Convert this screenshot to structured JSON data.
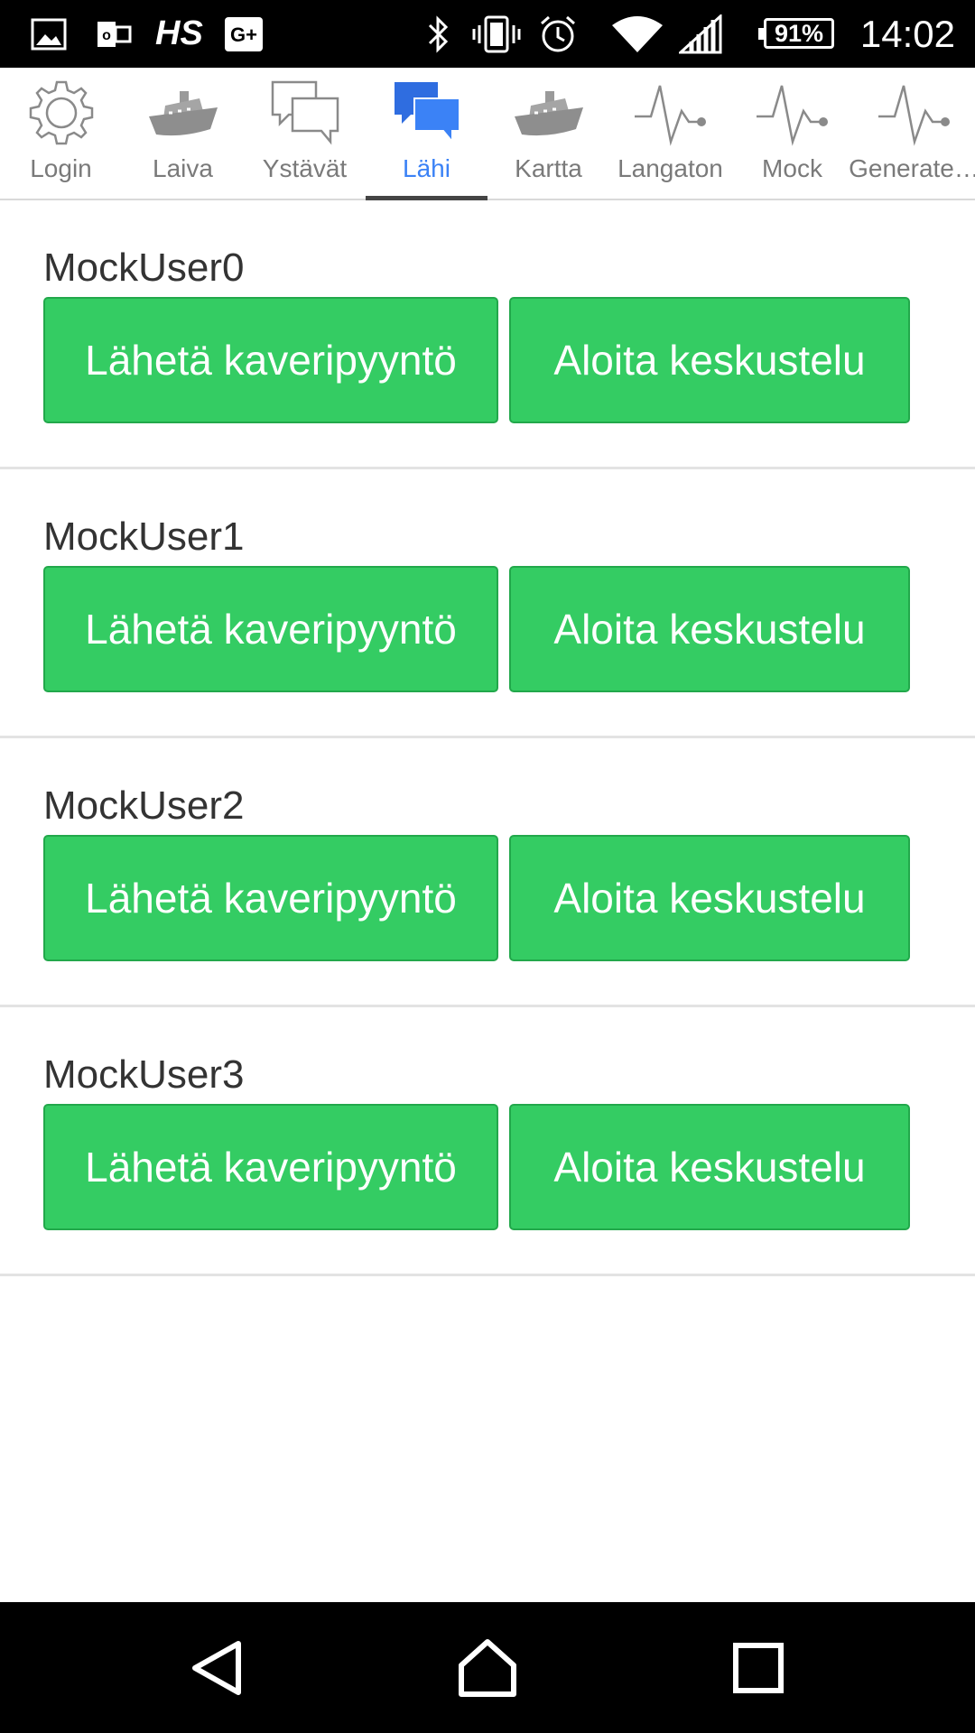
{
  "status_bar": {
    "time": "14:02",
    "battery": "91%",
    "left_text": "HS",
    "icons": [
      "image-icon",
      "outlook-icon",
      "hs-icon",
      "google-plus-icon",
      "bluetooth-icon",
      "vibrate-icon",
      "alarm-icon",
      "wifi-icon",
      "signal-icon",
      "battery-icon"
    ]
  },
  "tabs": [
    {
      "label": "Login",
      "icon": "gear-icon",
      "active": false
    },
    {
      "label": "Laiva",
      "icon": "ship-icon",
      "active": false
    },
    {
      "label": "Ystävät",
      "icon": "chat-bubbles-icon",
      "active": false
    },
    {
      "label": "Lähi",
      "icon": "chat-bubbles-icon",
      "active": true
    },
    {
      "label": "Kartta",
      "icon": "ship-icon",
      "active": false
    },
    {
      "label": "Langaton",
      "icon": "pulse-icon",
      "active": false
    },
    {
      "label": "Mock",
      "icon": "pulse-icon",
      "active": false
    },
    {
      "label": "Generate…",
      "icon": "pulse-icon",
      "active": false
    }
  ],
  "users": [
    {
      "name": "MockUser0",
      "friend_button": "Lähetä kaveripyyntö",
      "chat_button": "Aloita keskustelu"
    },
    {
      "name": "MockUser1",
      "friend_button": "Lähetä kaveripyyntö",
      "chat_button": "Aloita keskustelu"
    },
    {
      "name": "MockUser2",
      "friend_button": "Lähetä kaveripyyntö",
      "chat_button": "Aloita keskustelu"
    },
    {
      "name": "MockUser3",
      "friend_button": "Lähetä kaveripyyntö",
      "chat_button": "Aloita keskustelu"
    }
  ],
  "colors": {
    "button_green": "#34cc63",
    "active_tab": "#3b82f6",
    "inactive_tab": "#7a7a7a"
  },
  "nav_bar": {
    "icons": [
      "back-icon",
      "home-icon",
      "recents-icon"
    ]
  }
}
